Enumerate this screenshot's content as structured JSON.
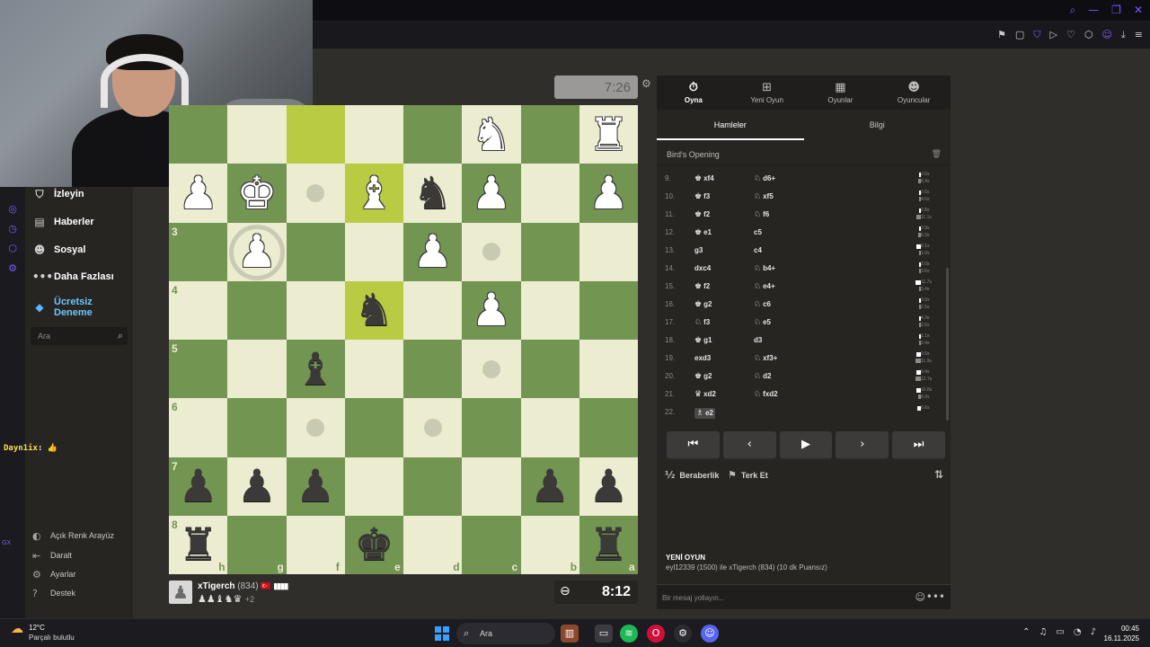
{
  "topbar": {
    "window_icons": [
      "search-icon",
      "minimize-icon",
      "restore-icon",
      "close-icon"
    ]
  },
  "sidebar": {
    "items": [
      {
        "label": "İzleyin",
        "icon": "binoculars-icon"
      },
      {
        "label": "Haberler",
        "icon": "news-icon"
      },
      {
        "label": "Sosyal",
        "icon": "social-icon"
      },
      {
        "label": "Daha Fazlası",
        "icon": "more-icon"
      },
      {
        "label": "Ücretsiz Deneme",
        "icon": "diamond-icon"
      }
    ],
    "search_placeholder": "Ara",
    "bottom": [
      {
        "label": "Açık Renk Arayüz",
        "icon": "contrast-icon"
      },
      {
        "label": "Daralt",
        "icon": "collapse-icon"
      },
      {
        "label": "Ayarlar",
        "icon": "gear-icon"
      },
      {
        "label": "Destek",
        "icon": "help-icon"
      }
    ]
  },
  "chat_overlay": {
    "user": "Dayn1ix",
    "text": ": 👍"
  },
  "gx_label": "GX",
  "board": {
    "orientation": "black-bottom",
    "ranks": [
      "3",
      "4",
      "5",
      "6",
      "7",
      "8"
    ],
    "files": [
      "h",
      "g",
      "f",
      "e",
      "d",
      "c",
      "b",
      "a"
    ],
    "top_clock": "7:26",
    "bottom_clock": "8:12",
    "pieces": [
      {
        "square": "c1",
        "type": "knight",
        "color": "white"
      },
      {
        "square": "a1",
        "type": "rook",
        "color": "white"
      },
      {
        "square": "h2",
        "type": "pawn",
        "color": "white"
      },
      {
        "square": "g2",
        "type": "king",
        "color": "white"
      },
      {
        "square": "e2",
        "type": "bishop",
        "color": "white"
      },
      {
        "square": "d2",
        "type": "knight",
        "color": "black"
      },
      {
        "square": "c2",
        "type": "pawn",
        "color": "white"
      },
      {
        "square": "a2",
        "type": "pawn",
        "color": "white"
      },
      {
        "square": "g3",
        "type": "pawn",
        "color": "white"
      },
      {
        "square": "d3",
        "type": "pawn",
        "color": "white"
      },
      {
        "square": "e4",
        "type": "knight",
        "color": "black"
      },
      {
        "square": "c4",
        "type": "pawn",
        "color": "white"
      },
      {
        "square": "f5",
        "type": "bishop",
        "color": "black"
      },
      {
        "square": "h7",
        "type": "pawn",
        "color": "black"
      },
      {
        "square": "g7",
        "type": "pawn",
        "color": "black"
      },
      {
        "square": "f7",
        "type": "pawn",
        "color": "black"
      },
      {
        "square": "b7",
        "type": "pawn",
        "color": "black"
      },
      {
        "square": "a7",
        "type": "pawn",
        "color": "black"
      },
      {
        "square": "h8",
        "type": "rook",
        "color": "black"
      },
      {
        "square": "e8",
        "type": "king",
        "color": "black"
      },
      {
        "square": "a8",
        "type": "rook",
        "color": "black"
      }
    ],
    "highlights": [
      "f1",
      "e2",
      "e4"
    ],
    "move_dots": [
      "f2",
      "c3",
      "c5",
      "f6",
      "d6"
    ],
    "capture_rings": [
      "g3"
    ]
  },
  "player": {
    "name": "xTigerch",
    "rating": "(834)",
    "flag": "🇹🇷",
    "signal": "▮▮▮▮",
    "captured": "♟♟♝♞♛",
    "material": "+2"
  },
  "panel": {
    "tabs": [
      {
        "label": "Oyna",
        "icon": "stopwatch-icon",
        "active": true
      },
      {
        "label": "Yeni Oyun",
        "icon": "plus-icon",
        "active": false
      },
      {
        "label": "Oyunlar",
        "icon": "board-icon",
        "active": false
      },
      {
        "label": "Oyuncular",
        "icon": "players-icon",
        "active": false
      }
    ],
    "subtabs": [
      {
        "label": "Hamleler",
        "active": true
      },
      {
        "label": "Bilgi",
        "active": false
      }
    ],
    "opening": "Bird's Opening",
    "moves": [
      {
        "n": "9.",
        "w": "xf4",
        "wi": "♚",
        "b": "d6+",
        "bi": "♘",
        "tw": "2.6s",
        "tb": "6.4s",
        "fw": 0.3,
        "fb": 0.5
      },
      {
        "n": "10.",
        "w": "f3",
        "wi": "♚",
        "b": "xf5",
        "bi": "♘",
        "tw": "2.6s",
        "tb": "4.6s",
        "fw": 0.3,
        "fb": 0.4
      },
      {
        "n": "11.",
        "w": "f2",
        "wi": "♚",
        "b": "f6",
        "bi": "♘",
        "tw": "2.8s",
        "tb": "11.1s",
        "fw": 0.3,
        "fb": 0.9
      },
      {
        "n": "12.",
        "w": "e1",
        "wi": "♚",
        "b": "c5",
        "bi": "",
        "tw": "2.9s",
        "tb": "6.3s",
        "fw": 0.3,
        "fb": 0.5
      },
      {
        "n": "13.",
        "w": "g3",
        "wi": "",
        "b": "c4",
        "bi": "",
        "tw": "9.1s",
        "tb": "1.0s",
        "fw": 0.8,
        "fb": 0.1
      },
      {
        "n": "14.",
        "w": "dxc4",
        "wi": "",
        "b": "b4+",
        "bi": "♘",
        "tw": "2.0s",
        "tb": "3.6s",
        "fw": 0.2,
        "fb": 0.3
      },
      {
        "n": "15.",
        "w": "f2",
        "wi": "♚",
        "b": "e4+",
        "bi": "♘",
        "tw": "11.7s",
        "tb": "3.4s",
        "fw": 1.0,
        "fb": 0.3
      },
      {
        "n": "16.",
        "w": "g2",
        "wi": "♚",
        "b": "c6",
        "bi": "♘",
        "tw": "3.6s",
        "tb": "2.5s",
        "fw": 0.3,
        "fb": 0.2
      },
      {
        "n": "17.",
        "w": "f3",
        "wi": "♘",
        "b": "e5",
        "bi": "♘",
        "tw": "4.3s",
        "tb": "2.6s",
        "fw": 0.4,
        "fb": 0.2
      },
      {
        "n": "18.",
        "w": "g1",
        "wi": "♚",
        "b": "d3",
        "bi": "",
        "tw": "1.1s",
        "tb": "2.4s",
        "fw": 0.1,
        "fb": 0.2
      },
      {
        "n": "19.",
        "w": "exd3",
        "wi": "",
        "b": "xf3+",
        "bi": "♘",
        "tw": "9.5s",
        "tb": "11.9s",
        "fw": 0.8,
        "fb": 1.0
      },
      {
        "n": "20.",
        "w": "g2",
        "wi": "♚",
        "b": "d2",
        "bi": "♘",
        "tw": "9.4s",
        "tb": "12.7s",
        "fw": 0.8,
        "fb": 1.0
      },
      {
        "n": "21.",
        "w": "xd2",
        "wi": "♛",
        "b": "fxd2",
        "bi": "♘",
        "tw": "10.8s",
        "tb": "6.0s",
        "fw": 0.9,
        "fb": 0.5
      },
      {
        "n": "22.",
        "w": "e2",
        "wi": "♗",
        "b": "",
        "bi": "",
        "tw": "6.6s",
        "tb": "",
        "fw": 0.6,
        "fb": 0,
        "current": true
      }
    ],
    "nav": [
      "⏮",
      "‹",
      "▶",
      "›",
      "⏭"
    ],
    "draw_label": "Beraberlik",
    "resign_label": "Terk Et",
    "new_game_title": "YENİ OYUN",
    "new_game_desc": "eyl12339 (1500) ile xTigerch (834) (10 dk Puansız)",
    "chat_placeholder": "Bir mesaj yollayın..."
  },
  "taskbar": {
    "temp": "12°C",
    "weather_desc": "Parçalı bulutlu",
    "search_label": "Ara",
    "time": "00:45",
    "date": "16.11.2025"
  }
}
